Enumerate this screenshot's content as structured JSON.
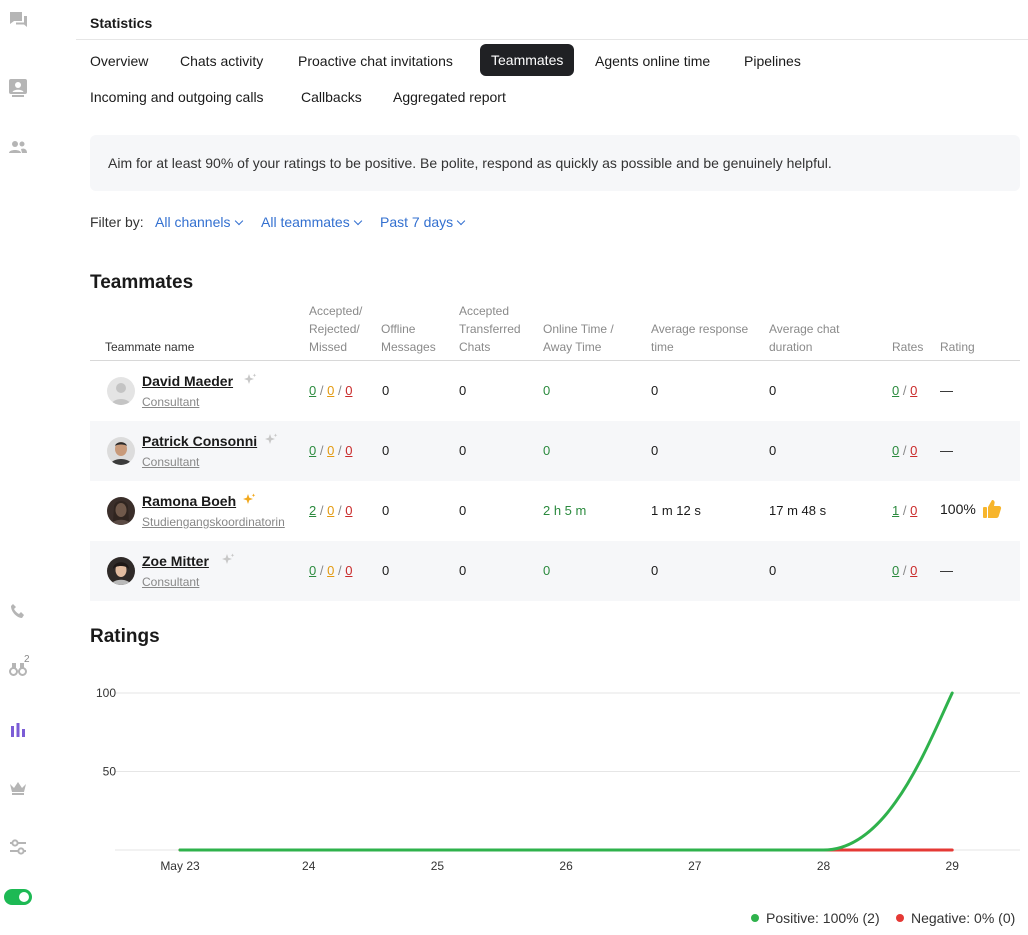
{
  "header": {
    "title": "Statistics"
  },
  "tabs": [
    {
      "label": "Overview",
      "active": false
    },
    {
      "label": "Chats activity",
      "active": false
    },
    {
      "label": "Proactive chat invitations",
      "active": false
    },
    {
      "label": "Teammates",
      "active": true
    },
    {
      "label": "Agents online time",
      "active": false
    },
    {
      "label": "Pipelines",
      "active": false
    },
    {
      "label": "Incoming and outgoing calls",
      "active": false
    },
    {
      "label": "Callbacks",
      "active": false
    },
    {
      "label": "Aggregated report",
      "active": false
    }
  ],
  "info": {
    "text": "Aim for at least 90% of your ratings to be positive. Be polite, respond as quickly as possible and be genuinely helpful."
  },
  "filters": {
    "label": "Filter by:",
    "channels": "All channels",
    "teammates": "All teammates",
    "period": "Past 7 days"
  },
  "rail": {
    "reports_badge": "2"
  },
  "teammates": {
    "title": "Teammates",
    "columns": {
      "name": "Teammate name",
      "accepted_1": "Accepted/",
      "accepted_2": "Rejected/",
      "accepted_3": "Missed",
      "offline_1": "Offline",
      "offline_2": "Messages",
      "transferred_1": "Accepted",
      "transferred_2": "Transferred",
      "transferred_3": "Chats",
      "online_1": "Online Time /",
      "online_2": "Away Time",
      "response_1": "Average response",
      "response_2": "time",
      "duration_1": "Average chat",
      "duration_2": "duration",
      "rates": "Rates",
      "rating": "Rating"
    },
    "slash": "/",
    "rows": [
      {
        "name": "David Maeder",
        "role": "Consultant",
        "accepted": "0",
        "rejected": "0",
        "missed": "0",
        "offline": "0",
        "transferred": "0",
        "online": "0",
        "response": "0",
        "duration": "0",
        "rates_pos": "0",
        "rates_neg": "0",
        "rating": "—",
        "avatar": "placeholder",
        "spark_color": "#c8c8c8"
      },
      {
        "name": "Patrick Consonni",
        "role": "Consultant",
        "accepted": "0",
        "rejected": "0",
        "missed": "0",
        "offline": "0",
        "transferred": "0",
        "online": "0",
        "response": "0",
        "duration": "0",
        "rates_pos": "0",
        "rates_neg": "0",
        "rating": "—",
        "avatar": "photo",
        "spark_color": "#c8c8c8"
      },
      {
        "name": "Ramona Boeh",
        "role": "Studiengangskoordinatorin",
        "accepted": "2",
        "rejected": "0",
        "missed": "0",
        "offline": "0",
        "transferred": "0",
        "online": "2 h 5 m",
        "response": "1 m 12 s",
        "duration": "17 m 48 s",
        "rates_pos": "1",
        "rates_neg": "0",
        "rating": "100%",
        "avatar": "photo",
        "spark_color": "#f2a91e"
      },
      {
        "name": "Zoe Mitter",
        "role": "Consultant",
        "accepted": "0",
        "rejected": "0",
        "missed": "0",
        "offline": "0",
        "transferred": "0",
        "online": "0",
        "response": "0",
        "duration": "0",
        "rates_pos": "0",
        "rates_neg": "0",
        "rating": "—",
        "avatar": "photo",
        "spark_color": "#c8c8c8"
      }
    ]
  },
  "ratings": {
    "title": "Ratings"
  },
  "chart_data": {
    "type": "line",
    "title": "",
    "xlabel": "",
    "ylabel": "",
    "categories": [
      "May 23",
      "24",
      "25",
      "26",
      "27",
      "28",
      "29"
    ],
    "ylim": [
      0,
      100
    ],
    "yticks": [
      "100",
      "50"
    ],
    "grid": true,
    "series": [
      {
        "name": "Positive",
        "color": "#2fb24c",
        "values": [
          0,
          0,
          0,
          0,
          0,
          0,
          100
        ]
      },
      {
        "name": "Negative",
        "color": "#e53935",
        "values": [
          0,
          0,
          0,
          0,
          0,
          0,
          0
        ]
      }
    ],
    "legend": {
      "placement": "bottom-right",
      "positive": "Positive: 100% (2)",
      "negative": "Negative: 0% (0)"
    }
  },
  "colors": {
    "accent": "#3370d0",
    "positive": "#2fb24c",
    "negative": "#e53935",
    "active_tab": "#202124"
  }
}
